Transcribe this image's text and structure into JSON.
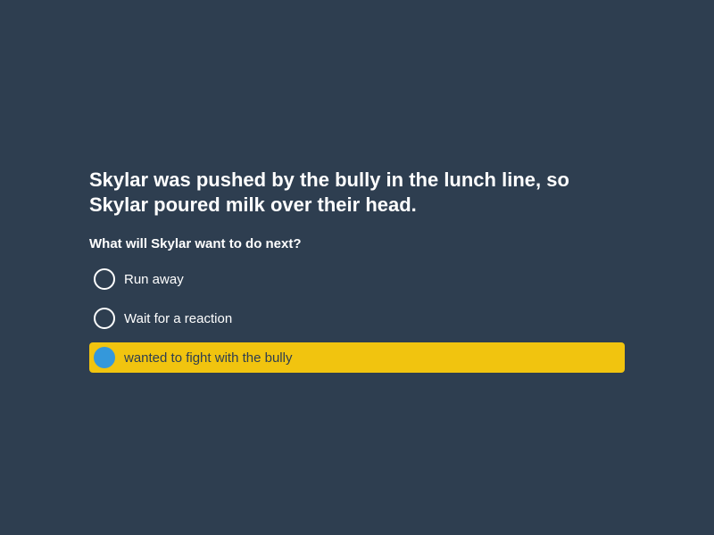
{
  "question": {
    "text": "Skylar was pushed by the bully in the lunch line, so Skylar poured milk over their head.",
    "prompt": "What will Skylar want to do next?"
  },
  "options": [
    {
      "label": "Run away",
      "selected": false
    },
    {
      "label": "Wait for a reaction",
      "selected": false
    },
    {
      "label": "wanted to fight with the bully",
      "selected": true
    }
  ],
  "colors": {
    "background": "#2e3e50",
    "selected_highlight": "#f1c40f",
    "selected_radio": "#3498db",
    "text": "#ffffff"
  }
}
